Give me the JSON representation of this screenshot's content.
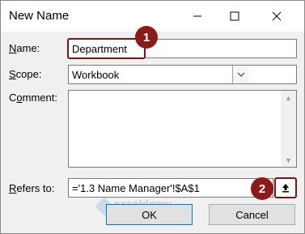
{
  "window": {
    "title": "New Name"
  },
  "form": {
    "name_label_u": "N",
    "name_label_rest": "ame:",
    "name_value": "Department",
    "scope_label_u": "S",
    "scope_label_rest": "cope:",
    "scope_value": "Workbook",
    "comment_label_pre": "C",
    "comment_label_u": "o",
    "comment_label_rest": "mment:",
    "comment_value": "",
    "refers_label_u": "R",
    "refers_label_rest": "efers to:",
    "refers_value": "='1.3 Name Manager'!$A$1"
  },
  "buttons": {
    "ok_label": "OK",
    "cancel_label": "Cancel"
  },
  "annotations": {
    "badge_1": "1",
    "badge_2": "2"
  },
  "watermark": {
    "brand": "exceldemy",
    "tagline": "EXCEL · DATA · BI"
  },
  "icons": {
    "minimize": "minimize-icon",
    "maximize": "maximize-icon",
    "close": "close-icon",
    "dropdown": "chevron-down-icon",
    "collapse": "collapse-dialog-icon"
  },
  "colors": {
    "annotation": "#8b1a1a",
    "dialog_bg": "#f0f0f0",
    "ok_border": "#0078d7"
  }
}
